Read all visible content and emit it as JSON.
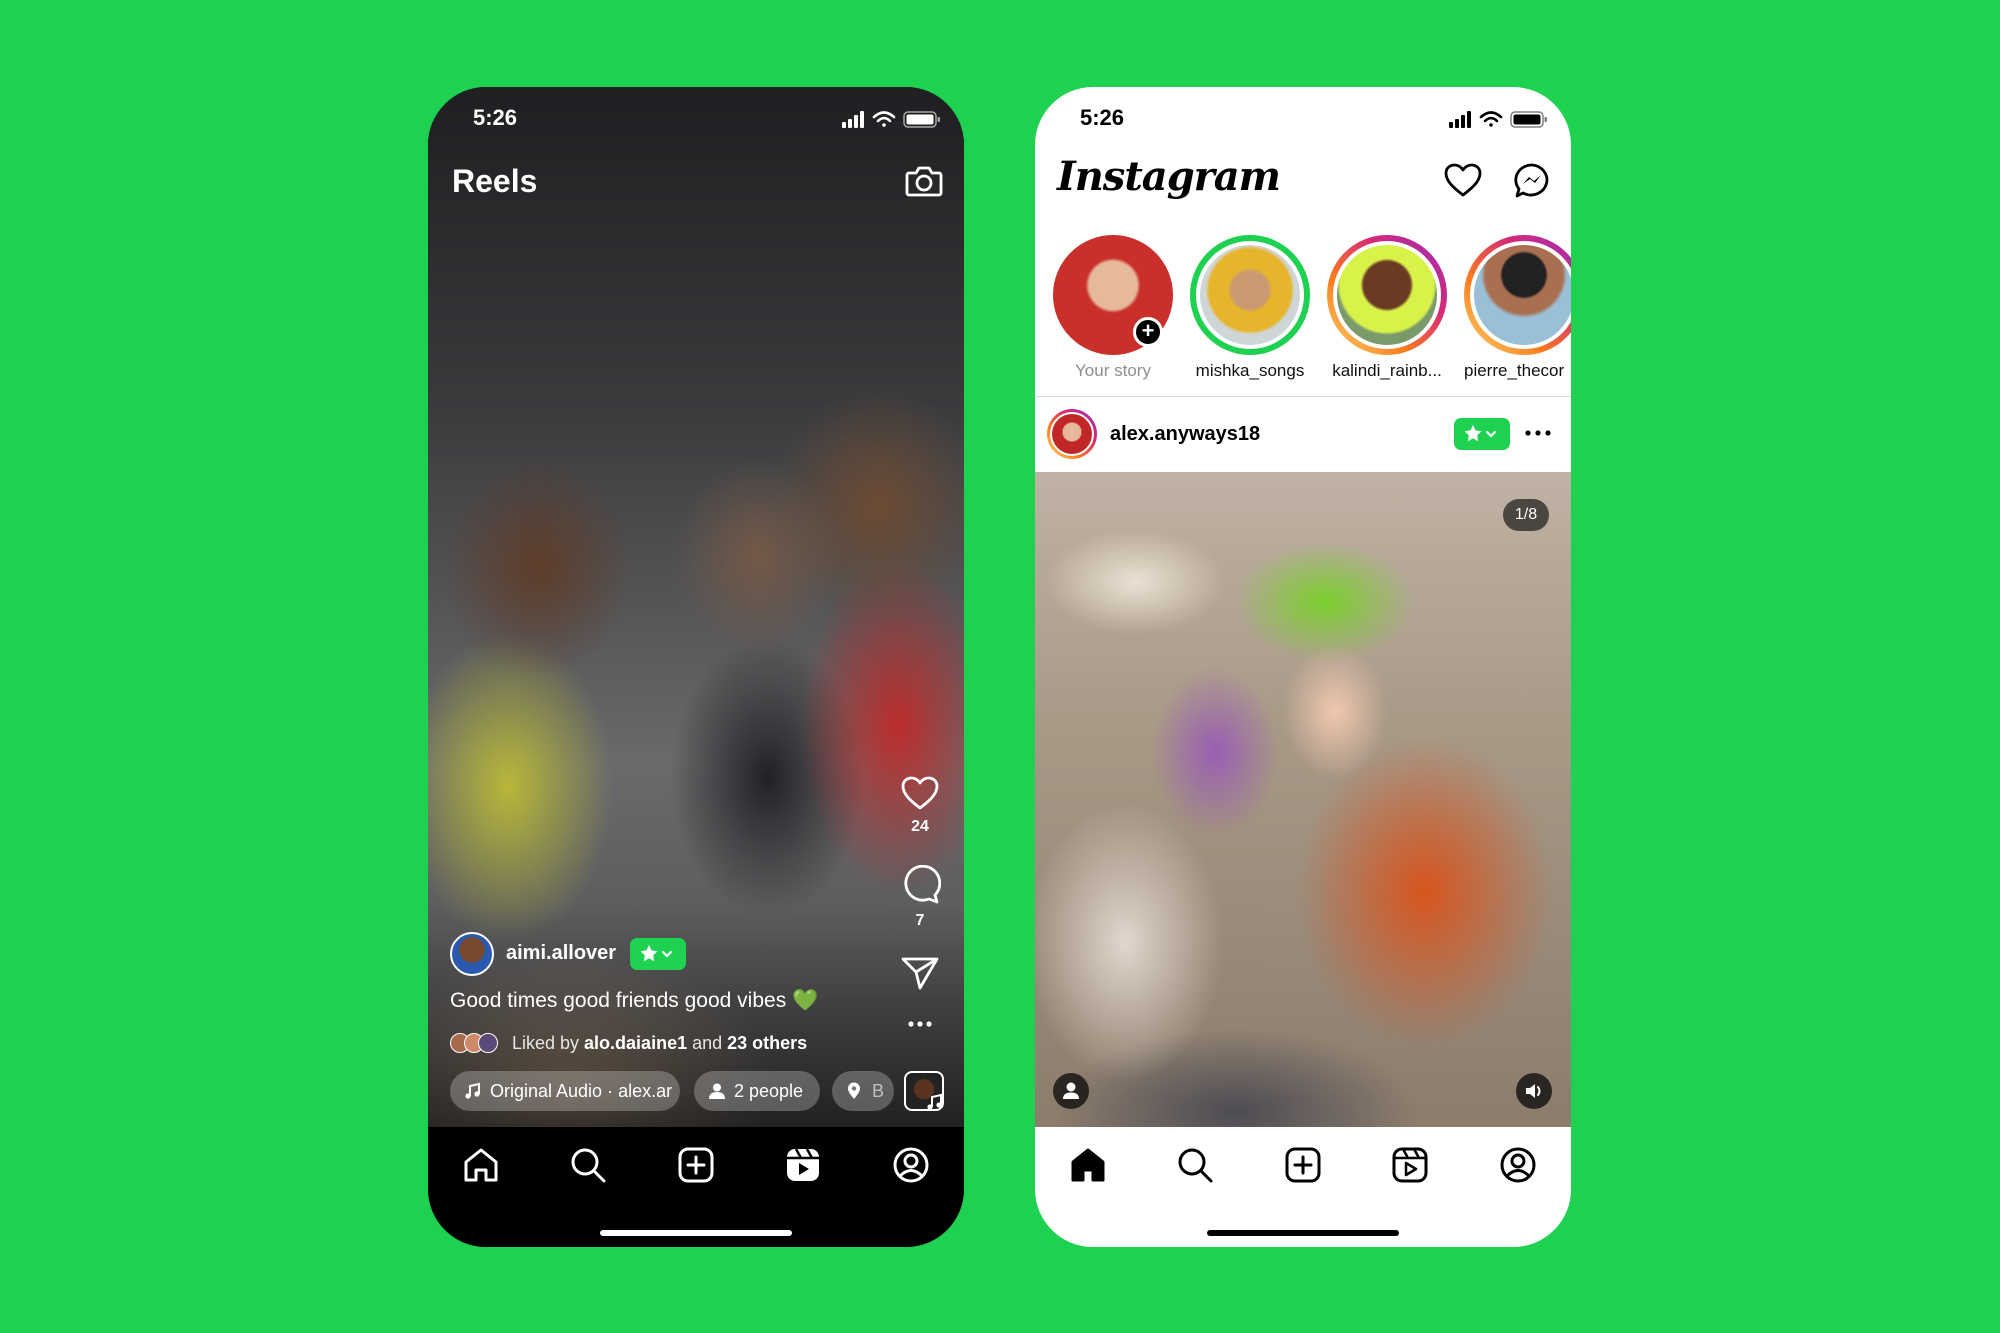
{
  "reels_screen": {
    "status": {
      "time": "5:26"
    },
    "title": "Reels",
    "actions": {
      "likes": "24",
      "comments": "7"
    },
    "author": {
      "username": "aimi.allover"
    },
    "caption": "Good times good friends good vibes 💚",
    "liked": {
      "prefix": "Liked by ",
      "user": "alo.daiaine1",
      "middle": " and ",
      "others": "23 others"
    },
    "pills": {
      "audio": "Original Audio · alex.ar",
      "people": "2 people",
      "location": "B"
    }
  },
  "feed_screen": {
    "status": {
      "time": "5:26"
    },
    "logo": "Instagram",
    "stories": [
      {
        "label": "Your story"
      },
      {
        "label": "mishka_songs"
      },
      {
        "label": "kalindi_rainb..."
      },
      {
        "label": "pierre_thecor"
      }
    ],
    "post": {
      "username": "alex.anyways18",
      "page_counter": "1/8"
    }
  },
  "colors": {
    "background": "#1ed150",
    "favorite_badge": "#1ed150",
    "close_friends_ring": "#1ed150",
    "story_gradient": [
      "#feda75",
      "#fa7e1e",
      "#d62976",
      "#962fbf"
    ]
  },
  "icons": [
    "camera-icon",
    "heart-icon",
    "comment-icon",
    "send-icon",
    "more-icon",
    "music-icon",
    "person-icon",
    "location-icon",
    "star-icon",
    "chevron-down-icon",
    "home-icon",
    "search-icon",
    "create-icon",
    "reels-icon",
    "profile-icon",
    "messenger-icon",
    "volume-icon",
    "signal-icon",
    "wifi-icon",
    "battery-icon"
  ]
}
